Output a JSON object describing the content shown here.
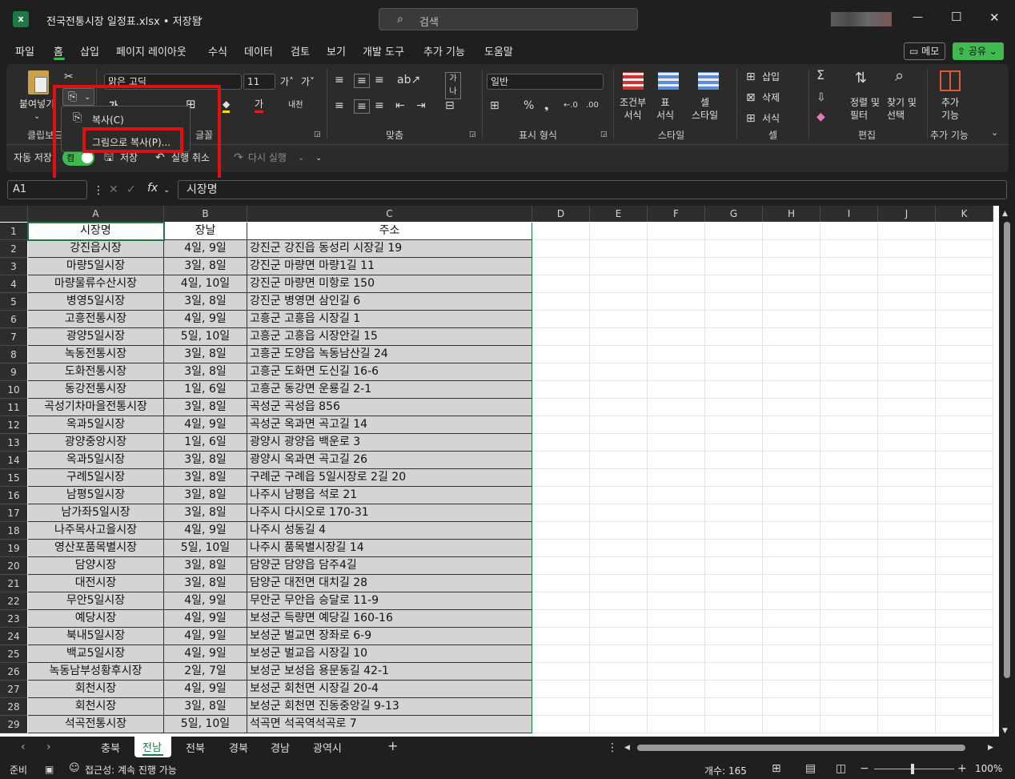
{
  "titlebar": {
    "app_icon": "excel-icon",
    "filename": "전국전통시장 일정표.xlsx • 저장됨",
    "search_placeholder": "검색",
    "minimize": "—",
    "maximize": "☐",
    "close": "✕"
  },
  "menu": {
    "tabs": [
      "파일",
      "홈",
      "삽입",
      "페이지 레이아웃",
      "수식",
      "데이터",
      "검토",
      "보기",
      "개발 도구",
      "추가 기능",
      "도움말"
    ],
    "memo_label": "메모",
    "share_label": "공유"
  },
  "ribbon": {
    "paste_label": "붙여넣기",
    "clipboard_label": "클립보드",
    "font_name": "맑은 고딕",
    "font_size": "11",
    "font_group_label": "글꼴",
    "align_group_label": "맞춤",
    "number_format": "일반",
    "number_group_label": "표시 형식",
    "cond_format_label": "조건부\n서식",
    "table_format_label": "표\n서식",
    "cell_style_label": "셀\n스타일",
    "style_group_label": "스타일",
    "insert_label": "삽입",
    "delete_label": "삭제",
    "format_label": "서식",
    "cells_group_label": "셀",
    "sort_filter_label": "정렬 및\n필터",
    "find_select_label": "찾기 및\n선택",
    "edit_group_label": "편집",
    "addins_label": "추가\n기능",
    "addins_group_label": "추가 기능"
  },
  "qat": {
    "autosave_label": "자동 저장",
    "autosave_state": "켬",
    "save_label": "저장",
    "undo_label": "실행 취소",
    "redo_label": "다시 실행"
  },
  "copy_dropdown": {
    "copy_label": "복사(C)",
    "copy_picture_label": "그림으로 복사(P)..."
  },
  "formula": {
    "name_box": "A1",
    "fx": "fx",
    "content": "시장명"
  },
  "columns": [
    "A",
    "B",
    "C",
    "D",
    "E",
    "F",
    "G",
    "H",
    "I",
    "J",
    "K"
  ],
  "header_row": [
    "시장명",
    "장날",
    "주소"
  ],
  "rows": [
    [
      "강진읍시장",
      "4일, 9일",
      "강진군 강진읍 동성리 시장길 19"
    ],
    [
      "마량5일시장",
      "3일, 8일",
      "강진군 마량면 마량1길 11"
    ],
    [
      "마량물류수산시장",
      "4일, 10일",
      "강진군 마량면 미항로 150"
    ],
    [
      "병영5일시장",
      "3일, 8일",
      "강진군 병영면 삼인길 6"
    ],
    [
      "고흥전통시장",
      "4일, 9일",
      "고흥군 고흥읍 시장길 1"
    ],
    [
      "광양5일시장",
      "5일, 10일",
      "고흥군 고흥읍 시장안길 15"
    ],
    [
      "녹동전통시장",
      "3일, 8일",
      "고흥군 도양읍 녹동남산길 24"
    ],
    [
      "도화전통시장",
      "3일, 8일",
      "고흥군 도화면 도신길 16-6"
    ],
    [
      "동강전통시장",
      "1일, 6일",
      "고흥군 동강면 운룡길 2-1"
    ],
    [
      "곡성기차마을전통시장",
      "3일, 8일",
      "곡성군 곡성읍 856"
    ],
    [
      "옥과5일시장",
      "4일, 9일",
      "곡성군 옥과면 곡고길 14"
    ],
    [
      "광양중앙시장",
      "1일, 6일",
      "광양시 광양읍 백운로 3"
    ],
    [
      "옥과5일시장",
      "3일, 8일",
      "광양시 옥과면 곡고길 26"
    ],
    [
      "구례5일시장",
      "3일, 8일",
      "구례군 구례읍 5일시장로 2길 20"
    ],
    [
      "남평5일시장",
      "3일, 8일",
      "나주시 남평읍 석로 21"
    ],
    [
      "남가좌5일시장",
      "3일, 8일",
      "나주시 다시오로 170-31"
    ],
    [
      "나주목사고을시장",
      "4일, 9일",
      "나주시 성동길 4"
    ],
    [
      "영산포품목별시장",
      "5일, 10일",
      "나주시 품목별시장길 14"
    ],
    [
      "담양시장",
      "3일, 8일",
      "담양군 담양읍 담주4길"
    ],
    [
      "대전시장",
      "3일, 8일",
      "담양군 대전면 대치길 28"
    ],
    [
      "무안5일시장",
      "4일, 9일",
      "무안군 무안읍 승달로 11-9"
    ],
    [
      "예당시장",
      "4일, 9일",
      "보성군 득량면 예당길 160-16"
    ],
    [
      "북내5일시장",
      "4일, 9일",
      "보성군 벌교면 장좌로 6-9"
    ],
    [
      "백교5일시장",
      "4일, 9일",
      "보성군 벌교읍 시장길 10"
    ],
    [
      "녹동남부성황후시장",
      "2일, 7일",
      "보성군 보성읍 용문동길 42-1"
    ],
    [
      "회천시장",
      "4일, 9일",
      "보성군 회천면 시장길 20-4"
    ],
    [
      "회천시장",
      "3일, 8일",
      "보성군 회천면 진동중앙길 9-13"
    ],
    [
      "석곡전통시장",
      "5일, 10일",
      "석곡면 석곡역석곡로 7"
    ]
  ],
  "sheets": [
    "충북",
    "전남",
    "전북",
    "경북",
    "경남",
    "광역시"
  ],
  "active_sheet": "전남",
  "status": {
    "ready": "준비",
    "accessibility": "접근성: 계속 진행 가능",
    "count": "개수: 165",
    "zoom": "100%"
  },
  "colors": {
    "highlight_box": "#e01010",
    "share_green": "#3fb950",
    "cell_fill": "#d4d4d4"
  }
}
